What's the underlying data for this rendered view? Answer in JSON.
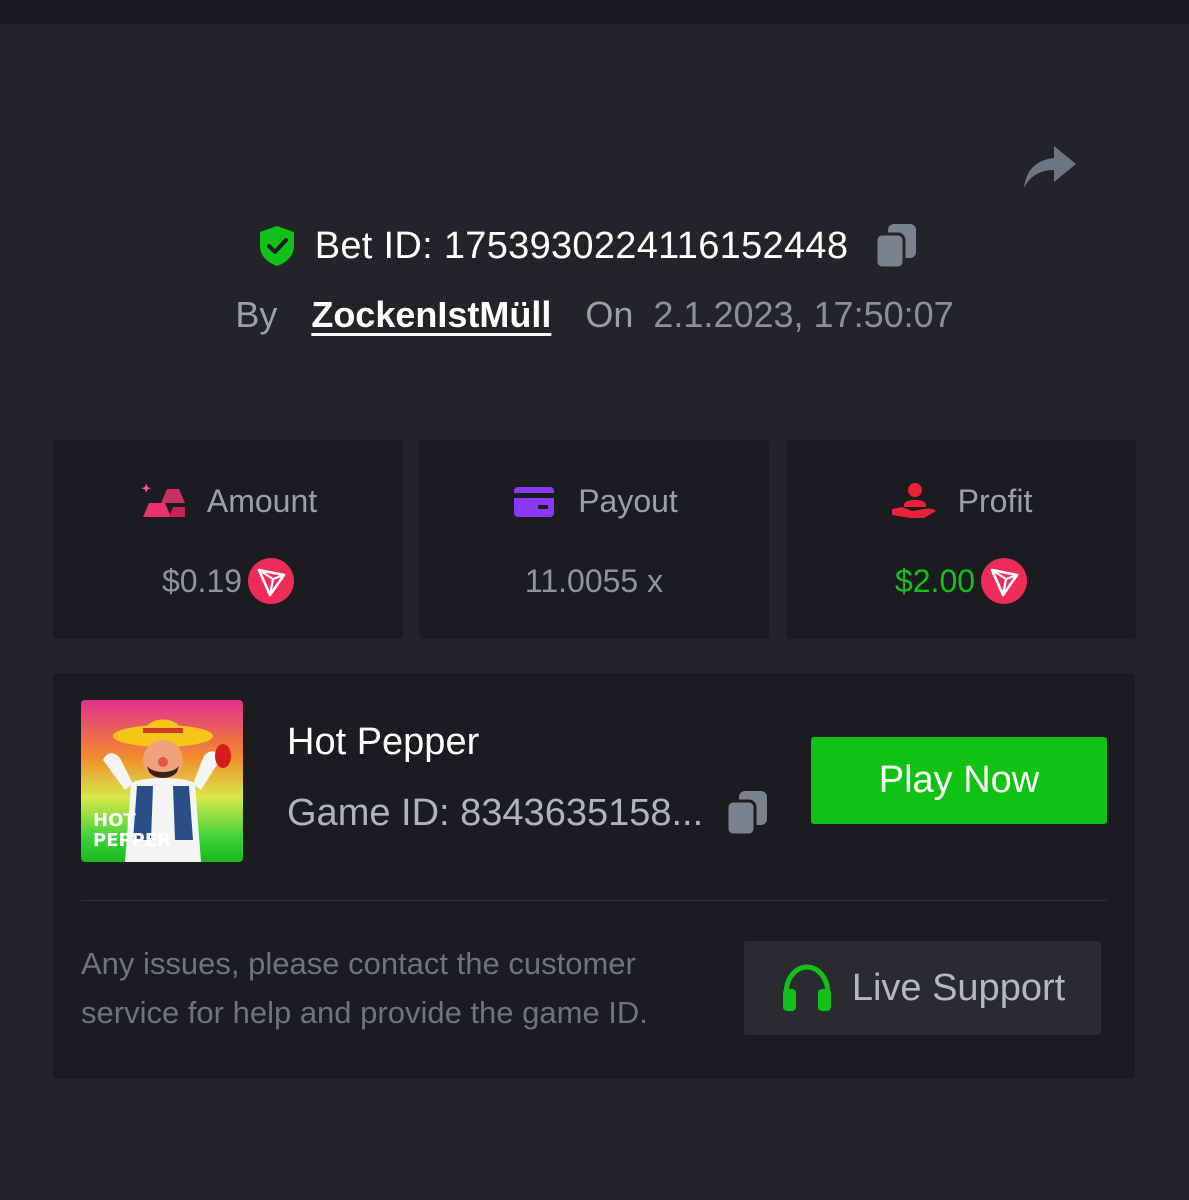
{
  "bet": {
    "id_text": "Bet ID: 1753930224116152448",
    "by_label": "By",
    "username": "ZockenIstMüll",
    "on_label": "On",
    "datetime": "2.1.2023, 17:50:07"
  },
  "stats": [
    {
      "label": "Amount",
      "value": "$0.19",
      "icon": "gold-bars-icon",
      "currency_icon": "tron-icon"
    },
    {
      "label": "Payout",
      "value": "11.0055 x",
      "icon": "card-icon"
    },
    {
      "label": "Profit",
      "value": "$2.00",
      "icon": "hand-user-icon",
      "currency_icon": "tron-icon"
    }
  ],
  "game": {
    "name": "Hot Pepper",
    "id_text": "Game ID: 8343635158...",
    "thumbnail_text_line1": "HOT",
    "thumbnail_text_line2": "PEPPER",
    "play_label": "Play Now"
  },
  "support": {
    "help_text": "Any issues, please contact the customer service for help and provide the game ID.",
    "button_label": "Live Support"
  },
  "colors": {
    "background": "#232428",
    "card": "#1b1c1f",
    "accent_green": "#10c312",
    "profit_green": "#11c11a",
    "tron_red": "#ef2b5a"
  }
}
